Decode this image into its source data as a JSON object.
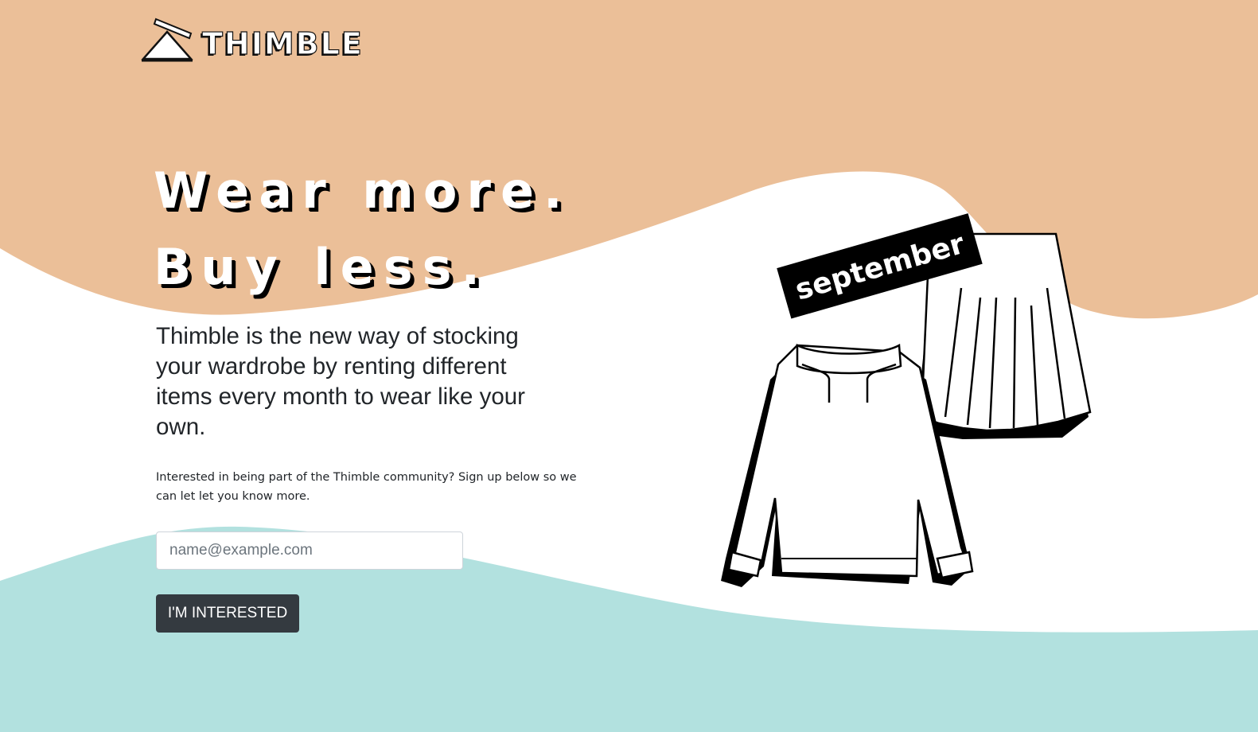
{
  "brand": {
    "name": "THIMBLE"
  },
  "colors": {
    "peach": "#EBBF98",
    "teal": "#B2E1DF",
    "button": "#343A40",
    "text": "#212529"
  },
  "hero": {
    "headline_line1": "Wear more.",
    "headline_line2": "Buy less.",
    "lead": "Thimble is the new way of stocking your wardrobe by renting different items every month to wear like your own.",
    "sub": "Interested in being part of the Thimble community? Sign up below so we can let let you know more."
  },
  "signup": {
    "placeholder": "name@example.com",
    "value": "",
    "button_label": "I'M INTERESTED"
  },
  "illustration": {
    "tag_label": "september",
    "items": [
      "sweater",
      "skirt"
    ]
  }
}
